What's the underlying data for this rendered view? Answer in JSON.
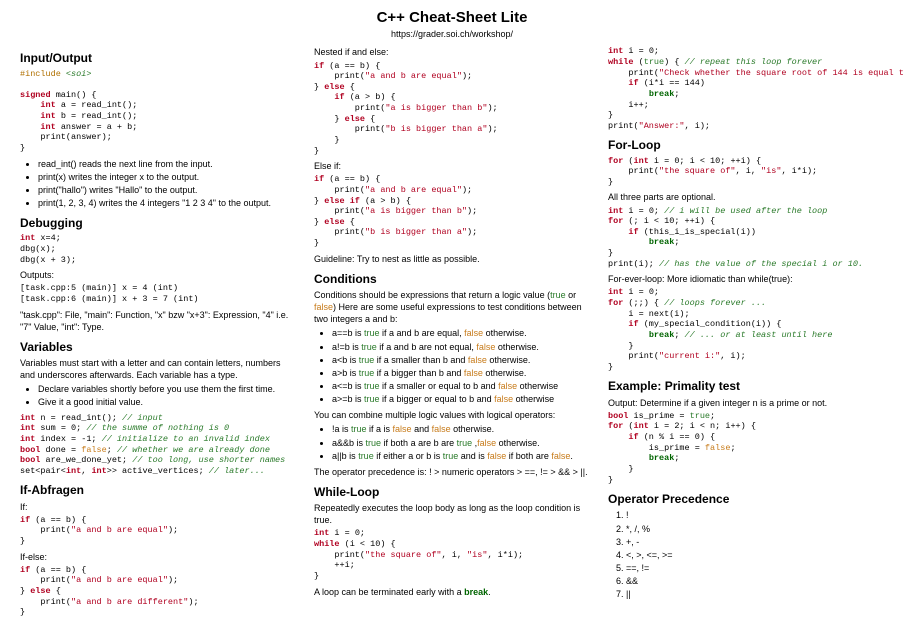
{
  "header": {
    "title": "C++ Cheat-Sheet Lite",
    "url": "https://grader.soi.ch/workshop/"
  },
  "col1": {
    "io_h": "Input/Output",
    "io_bul1": "read_int() reads the next line from the input.",
    "io_bul2": "print(x) writes the integer x to the output.",
    "io_bul3": "print(\"hallo\") writes \"Hallo\" to the output.",
    "io_bul4": "print(1, 2, 3, 4) writes the 4 integers \"1 2 3 4\" to the output.",
    "dbg_h": "Debugging",
    "dbg_out_label": "Outputs:",
    "dbg_out1": "[task.cpp:5 (main)] x = 4 (int)",
    "dbg_out2": "[task.cpp:6 (main)] x + 3 = 7 (int)",
    "dbg_expl": "\"task.cpp\": File, \"main\": Function, \"x\" bzw \"x+3\": Expression, \"4\" i.e. \"7\" Value, \"int\": Type.",
    "var_h": "Variables",
    "var_intro": "Variables must start with a letter and can contain letters, numbers and underscores afterwards. Each variable has a type.",
    "var_b1": "Declare variables shortly before you use them the first time.",
    "var_b2": "Give it a good initial value.",
    "if_h": "If-Abfragen",
    "if_lbl": "If:",
    "ifelse_lbl": "If-else:"
  },
  "col2": {
    "nest_lbl": "Nested if and else:",
    "elseif_lbl": "Else if:",
    "nest_guide": "Guideline: Try to nest as little as possible.",
    "cond_h": "Conditions",
    "cond_intro_a": "Conditions should be expressions that return a logic value (",
    "cond_intro_b": ") Here are some useful expressions to test conditions between two integers a and b:",
    "cond_or": " or ",
    "cond_combine": "You can combine multiple logic values with logical operators:",
    "cond_prec": "The operator precedence is: ! > numeric operators > ==, != > && > ||.",
    "while_h": "While-Loop",
    "while_intro": "Repeatedly executes the loop body as long as the loop condition is true.",
    "while_break_a": "A loop can be terminated early with a ",
    "while_break_b": "."
  },
  "col3": {
    "for_h": "For-Loop",
    "for_opt": "All three parts are optional.",
    "forever_intro": "For-ever-loop: More idiomatic than while(true):",
    "prim_h": "Example: Primality test",
    "prim_intro": "Output: Determine if a given integer n is a prime or not.",
    "op_h": "Operator Precedence",
    "ops": [
      "!",
      "*, /, %",
      "+, -",
      "<, >, <=, >=",
      "==, !=",
      "&&",
      "||"
    ]
  }
}
